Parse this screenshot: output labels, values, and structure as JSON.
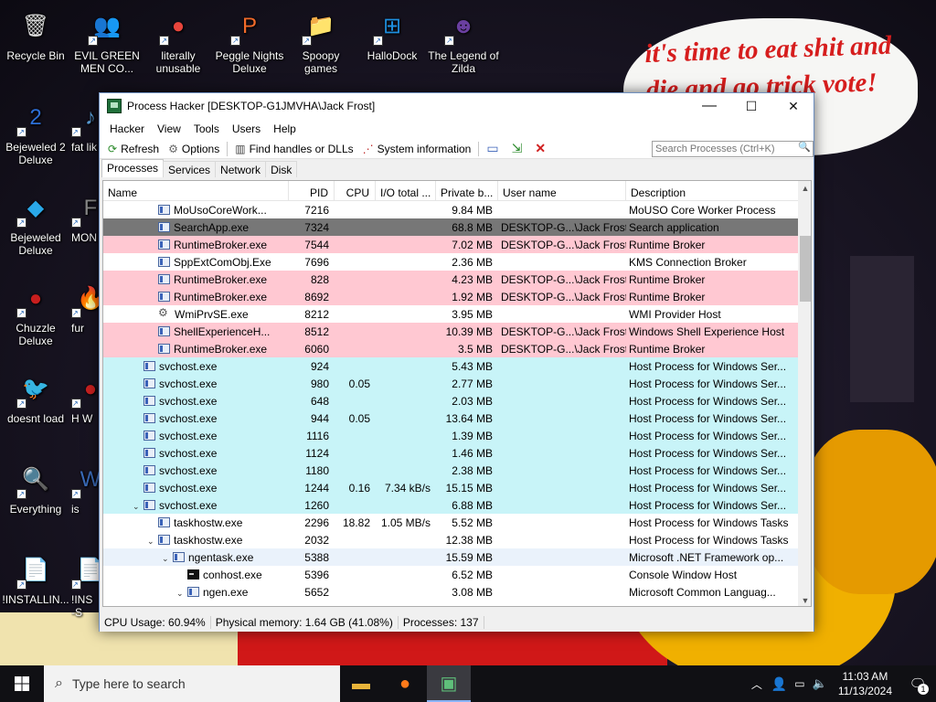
{
  "desktop": {
    "icons": [
      {
        "label": "Recycle Bin",
        "glyph": "🗑",
        "name": "recycle-bin-icon",
        "bg": "transparent"
      },
      {
        "label": "EVIL GREEN MEN CO...",
        "glyph": "👥",
        "name": "green-men-icon",
        "bg": "transparent"
      },
      {
        "label": "literally unusable",
        "glyph": "●",
        "name": "chrome-icon",
        "bg": "transparent"
      },
      {
        "label": "Peggle Nights Deluxe",
        "glyph": "P",
        "name": "peggle-icon",
        "bg": "transparent"
      },
      {
        "label": "Spoopy games",
        "glyph": "📁",
        "name": "folder-icon",
        "bg": "transparent"
      },
      {
        "label": "HalloDock",
        "glyph": "⊞",
        "name": "windows-logo-icon",
        "bg": "transparent"
      },
      {
        "label": "The Legend of Zilda",
        "glyph": "☻",
        "name": "zilda-icon",
        "bg": "transparent"
      },
      {
        "label": "Bejeweled 2 Deluxe",
        "glyph": "2",
        "name": "bejeweled2-icon",
        "bg": "transparent"
      },
      {
        "label": "fat lik",
        "glyph": "♪",
        "name": "fatlik-icon",
        "bg": "transparent"
      },
      {
        "label": "Bejeweled Deluxe",
        "glyph": "◆",
        "name": "bejeweled-icon",
        "bg": "transparent"
      },
      {
        "label": "MON",
        "glyph": "F",
        "name": "mon-icon",
        "bg": "transparent"
      },
      {
        "label": "Chuzzle Deluxe",
        "glyph": "●",
        "name": "chuzzle-icon",
        "bg": "transparent"
      },
      {
        "label": "fur",
        "glyph": "🔥",
        "name": "fur-icon",
        "bg": "transparent"
      },
      {
        "label": "doesnt load",
        "glyph": "🐦",
        "name": "thunderbird-icon",
        "bg": "transparent"
      },
      {
        "label": "H W",
        "glyph": "●",
        "name": "hw-icon",
        "bg": "transparent"
      },
      {
        "label": "Everything",
        "glyph": "🔍",
        "name": "everything-icon",
        "bg": "transparent"
      },
      {
        "label": "is",
        "glyph": "W",
        "name": "is-icon",
        "bg": "transparent"
      },
      {
        "label": "!INSTALLIN...",
        "glyph": "📄",
        "name": "installing-file-icon",
        "bg": "transparent"
      },
      {
        "label": "!INS -S",
        "glyph": "📄",
        "name": "ins-file-icon",
        "bg": "transparent"
      }
    ],
    "wallpaper_text": "it's time to eat shit and die and go trick vote!"
  },
  "window": {
    "title": "Process Hacker [DESKTOP-G1JMVHA\\Jack Frost]",
    "minimize": "—",
    "maximize": "☐",
    "close": "✕",
    "menu": [
      "Hacker",
      "View",
      "Tools",
      "Users",
      "Help"
    ],
    "toolbar": {
      "refresh": "Refresh",
      "options": "Options",
      "find_handles": "Find handles or DLLs",
      "system_info": "System information"
    },
    "search_placeholder": "Search Processes (Ctrl+K)",
    "tabs": [
      "Processes",
      "Services",
      "Network",
      "Disk"
    ],
    "columns": [
      "Name",
      "PID",
      "CPU",
      "I/O total ...",
      "Private b...",
      "User name",
      "Description"
    ],
    "rows": [
      {
        "indent": 4,
        "exp": "",
        "icon": "app",
        "name": "MoUsoCoreWork...",
        "pid": "7216",
        "cpu": "",
        "io": "",
        "priv": "9.84 MB",
        "user": "",
        "desc": "MoUSO Core Worker Process",
        "bg": "#ffffff",
        "fg": "#000000"
      },
      {
        "indent": 4,
        "exp": "",
        "icon": "app",
        "name": "SearchApp.exe",
        "pid": "7324",
        "cpu": "",
        "io": "",
        "priv": "68.8 MB",
        "user": "DESKTOP-G...\\Jack Frost",
        "desc": "Search application",
        "bg": "#777777",
        "fg": "#000000"
      },
      {
        "indent": 4,
        "exp": "",
        "icon": "app",
        "name": "RuntimeBroker.exe",
        "pid": "7544",
        "cpu": "",
        "io": "",
        "priv": "7.02 MB",
        "user": "DESKTOP-G...\\Jack Frost",
        "desc": "Runtime Broker",
        "bg": "#ffc8d2",
        "fg": "#000000"
      },
      {
        "indent": 4,
        "exp": "",
        "icon": "app",
        "name": "SppExtComObj.Exe",
        "pid": "7696",
        "cpu": "",
        "io": "",
        "priv": "2.36 MB",
        "user": "",
        "desc": "KMS Connection Broker",
        "bg": "#ffffff",
        "fg": "#000000"
      },
      {
        "indent": 4,
        "exp": "",
        "icon": "app",
        "name": "RuntimeBroker.exe",
        "pid": "828",
        "cpu": "",
        "io": "",
        "priv": "4.23 MB",
        "user": "DESKTOP-G...\\Jack Frost",
        "desc": "Runtime Broker",
        "bg": "#ffc8d2",
        "fg": "#000000"
      },
      {
        "indent": 4,
        "exp": "",
        "icon": "app",
        "name": "RuntimeBroker.exe",
        "pid": "8692",
        "cpu": "",
        "io": "",
        "priv": "1.92 MB",
        "user": "DESKTOP-G...\\Jack Frost",
        "desc": "Runtime Broker",
        "bg": "#ffc8d2",
        "fg": "#000000"
      },
      {
        "indent": 4,
        "exp": "",
        "icon": "gear",
        "name": "WmiPrvSE.exe",
        "pid": "8212",
        "cpu": "",
        "io": "",
        "priv": "3.95 MB",
        "user": "",
        "desc": "WMI Provider Host",
        "bg": "#ffffff",
        "fg": "#000000"
      },
      {
        "indent": 4,
        "exp": "",
        "icon": "app",
        "name": "ShellExperienceH...",
        "pid": "8512",
        "cpu": "",
        "io": "",
        "priv": "10.39 MB",
        "user": "DESKTOP-G...\\Jack Frost",
        "desc": "Windows Shell Experience Host",
        "bg": "#ffc8d2",
        "fg": "#000000"
      },
      {
        "indent": 4,
        "exp": "",
        "icon": "app",
        "name": "RuntimeBroker.exe",
        "pid": "6060",
        "cpu": "",
        "io": "",
        "priv": "3.5 MB",
        "user": "DESKTOP-G...\\Jack Frost",
        "desc": "Runtime Broker",
        "bg": "#ffc8d2",
        "fg": "#000000"
      },
      {
        "indent": 3,
        "exp": "",
        "icon": "app",
        "name": "svchost.exe",
        "pid": "924",
        "cpu": "",
        "io": "",
        "priv": "5.43 MB",
        "user": "",
        "desc": "Host Process for Windows Ser...",
        "bg": "#c8f4f8",
        "fg": "#000000"
      },
      {
        "indent": 3,
        "exp": "",
        "icon": "app",
        "name": "svchost.exe",
        "pid": "980",
        "cpu": "0.05",
        "io": "",
        "priv": "2.77 MB",
        "user": "",
        "desc": "Host Process for Windows Ser...",
        "bg": "#c8f4f8",
        "fg": "#000000"
      },
      {
        "indent": 3,
        "exp": "",
        "icon": "app",
        "name": "svchost.exe",
        "pid": "648",
        "cpu": "",
        "io": "",
        "priv": "2.03 MB",
        "user": "",
        "desc": "Host Process for Windows Ser...",
        "bg": "#c8f4f8",
        "fg": "#000000"
      },
      {
        "indent": 3,
        "exp": "",
        "icon": "app",
        "name": "svchost.exe",
        "pid": "944",
        "cpu": "0.05",
        "io": "",
        "priv": "13.64 MB",
        "user": "",
        "desc": "Host Process for Windows Ser...",
        "bg": "#c8f4f8",
        "fg": "#000000"
      },
      {
        "indent": 3,
        "exp": "",
        "icon": "app",
        "name": "svchost.exe",
        "pid": "1116",
        "cpu": "",
        "io": "",
        "priv": "1.39 MB",
        "user": "",
        "desc": "Host Process for Windows Ser...",
        "bg": "#c8f4f8",
        "fg": "#000000"
      },
      {
        "indent": 3,
        "exp": "",
        "icon": "app",
        "name": "svchost.exe",
        "pid": "1124",
        "cpu": "",
        "io": "",
        "priv": "1.46 MB",
        "user": "",
        "desc": "Host Process for Windows Ser...",
        "bg": "#c8f4f8",
        "fg": "#000000"
      },
      {
        "indent": 3,
        "exp": "",
        "icon": "app",
        "name": "svchost.exe",
        "pid": "1180",
        "cpu": "",
        "io": "",
        "priv": "2.38 MB",
        "user": "",
        "desc": "Host Process for Windows Ser...",
        "bg": "#c8f4f8",
        "fg": "#000000"
      },
      {
        "indent": 3,
        "exp": "",
        "icon": "app",
        "name": "svchost.exe",
        "pid": "1244",
        "cpu": "0.16",
        "io": "7.34 kB/s",
        "priv": "15.15 MB",
        "user": "",
        "desc": "Host Process for Windows Ser...",
        "bg": "#c8f4f8",
        "fg": "#000000"
      },
      {
        "indent": 3,
        "exp": "⌄",
        "icon": "app",
        "name": "svchost.exe",
        "pid": "1260",
        "cpu": "",
        "io": "",
        "priv": "6.88 MB",
        "user": "",
        "desc": "Host Process for Windows Ser...",
        "bg": "#c8f4f8",
        "fg": "#000000"
      },
      {
        "indent": 4,
        "exp": "",
        "icon": "app",
        "name": "taskhostw.exe",
        "pid": "2296",
        "cpu": "18.82",
        "io": "1.05 MB/s",
        "priv": "5.52 MB",
        "user": "",
        "desc": "Host Process for Windows Tasks",
        "bg": "#ffffff",
        "fg": "#000000"
      },
      {
        "indent": 4,
        "exp": "⌄",
        "icon": "app",
        "name": "taskhostw.exe",
        "pid": "2032",
        "cpu": "",
        "io": "",
        "priv": "12.38 MB",
        "user": "",
        "desc": "Host Process for Windows Tasks",
        "bg": "#ffffff",
        "fg": "#000000"
      },
      {
        "indent": 5,
        "exp": "⌄",
        "icon": "app",
        "name": "ngentask.exe",
        "pid": "5388",
        "cpu": "",
        "io": "",
        "priv": "15.59 MB",
        "user": "",
        "desc": "Microsoft .NET Framework op...",
        "bg": "#eaf2fb",
        "fg": "#000000"
      },
      {
        "indent": 6,
        "exp": "",
        "icon": "cons",
        "name": "conhost.exe",
        "pid": "5396",
        "cpu": "",
        "io": "",
        "priv": "6.52 MB",
        "user": "",
        "desc": "Console Window Host",
        "bg": "#ffffff",
        "fg": "#000000"
      },
      {
        "indent": 6,
        "exp": "⌄",
        "icon": "app",
        "name": "ngen.exe",
        "pid": "5652",
        "cpu": "",
        "io": "",
        "priv": "3.08 MB",
        "user": "",
        "desc": "Microsoft Common Languag...",
        "bg": "#ffffff",
        "fg": "#000000"
      }
    ],
    "status": {
      "cpu": "CPU Usage: 60.94%",
      "mem": "Physical memory: 1.64 GB (41.08%)",
      "procs": "Processes: 137"
    }
  },
  "taskbar": {
    "search_placeholder": "Type here to search",
    "time": "11:03 AM",
    "date": "11/13/2024",
    "notification_count": "1"
  }
}
